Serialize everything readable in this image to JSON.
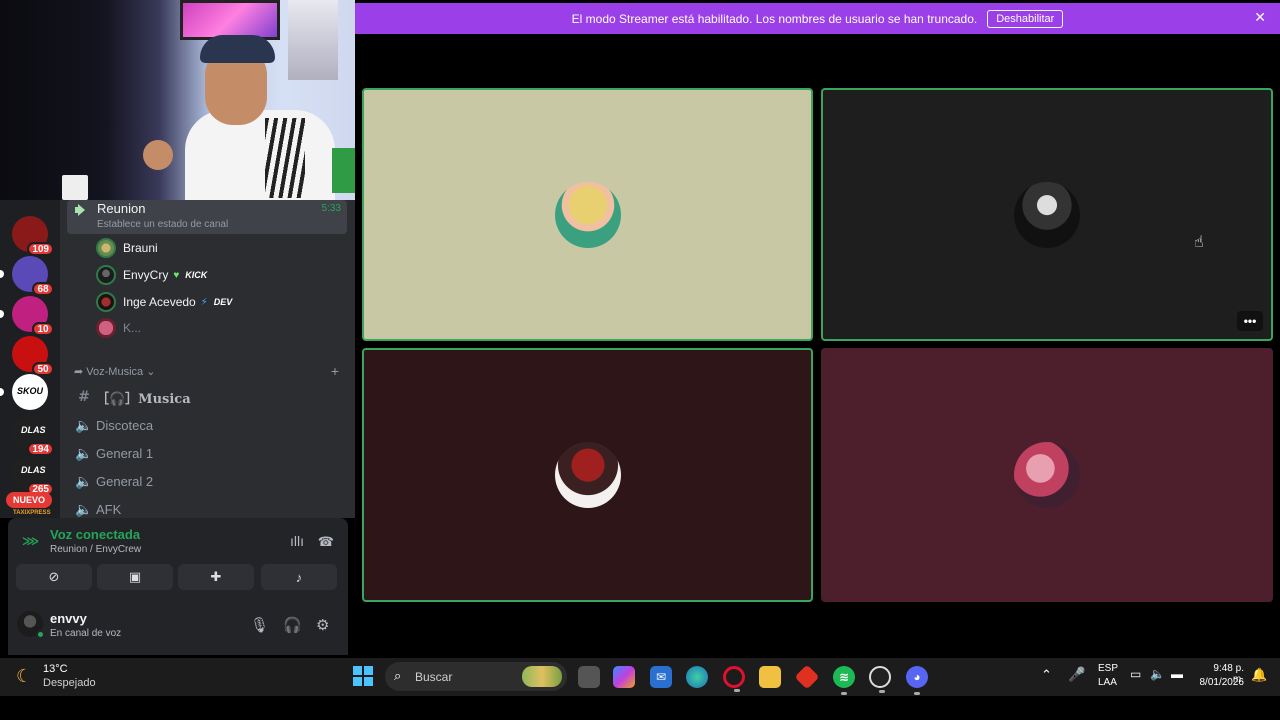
{
  "banner": {
    "text": "El modo Streamer está habilitado. Los nombres de usuario se han truncado.",
    "button_label": "Deshabilitar",
    "close_icon": "✕"
  },
  "servers": [
    {
      "badge": "109",
      "label": "",
      "color": "#8a1a1a"
    },
    {
      "badge": "68",
      "label": "",
      "color": "#5a4ab8"
    },
    {
      "badge": "10",
      "label": "",
      "color": "#c02080"
    },
    {
      "badge": "50",
      "label": "",
      "color": "#c81010"
    },
    {
      "badge": "",
      "label": "SKOU",
      "color": "#ffffff"
    },
    {
      "badge": "194",
      "label": "DLAS",
      "color": "#202020"
    },
    {
      "badge": "265",
      "label": "DLAS",
      "color": "#202020"
    }
  ],
  "nuevo_badge": "NUEVO",
  "nuevo_sub": "TAXIXPRESS",
  "channel": {
    "name": "Reunion",
    "timer": "5:33",
    "status": "Establece un estado de canal"
  },
  "members": [
    {
      "name": "Brauni",
      "tag": "",
      "tag_type": ""
    },
    {
      "name": "EnvyCry",
      "tag": "KICK",
      "tag_type": "heart"
    },
    {
      "name": "Inge Acevedo",
      "tag": "DEV",
      "tag_type": "bolt"
    },
    {
      "name": "K...",
      "tag": "",
      "tag_type": ""
    }
  ],
  "category": "Voz-Musica",
  "channels": [
    {
      "name": "［🎧］Musica",
      "type": "text"
    },
    {
      "name": "Discoteca",
      "type": "voice"
    },
    {
      "name": "General 1",
      "type": "voice"
    },
    {
      "name": "General 2",
      "type": "voice"
    },
    {
      "name": "AFK",
      "type": "voice"
    }
  ],
  "voice_panel": {
    "title": "Voz conectada",
    "subtitle": "Reunion / EnvyCrew"
  },
  "user": {
    "name": "envvy",
    "status": "En canal de voz"
  },
  "tiles": [
    {
      "bg": "#c8c8a4"
    },
    {
      "bg": "#1e1e1f"
    },
    {
      "bg": "#2e1518"
    },
    {
      "bg": "#4d1f2d"
    }
  ],
  "taskbar": {
    "weather_temp": "13°C",
    "weather_cond": "Despejado",
    "search_placeholder": "Buscar",
    "lang1": "ESP",
    "lang2": "LAA",
    "time": "9:48 p. m.",
    "date": "8/01/2026"
  },
  "colors": {
    "banner": "#9b3fe8",
    "speaking_border": "#3ba55d",
    "connected_green": "#23a55a"
  }
}
